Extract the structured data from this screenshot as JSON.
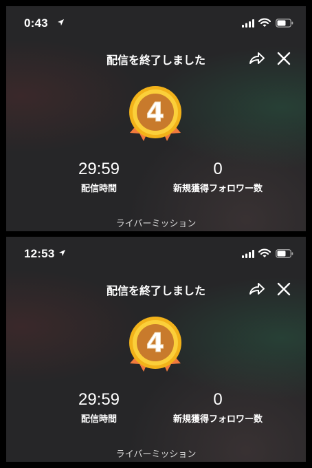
{
  "screens": [
    {
      "status_bar": {
        "time": "0:43",
        "location_icon": "location-arrow-icon",
        "signal_icon": "signal-icon",
        "wifi_icon": "wifi-icon",
        "battery_icon": "battery-icon"
      },
      "header": {
        "title": "配信を終了しました",
        "share_icon": "share-icon",
        "close_icon": "close-icon"
      },
      "medal": {
        "rank": "4",
        "colors": {
          "gold": "#f2b21a",
          "ribbon": "#f27a3c",
          "inner": "#c87a2c"
        }
      },
      "stats": {
        "duration_value": "29:59",
        "duration_label": "配信時間",
        "followers_value": "0",
        "followers_label": "新規獲得フォロワー数"
      },
      "footer": {
        "mission_link": "ライバーミッション"
      }
    },
    {
      "status_bar": {
        "time": "12:53",
        "location_icon": "location-arrow-icon",
        "signal_icon": "signal-icon",
        "wifi_icon": "wifi-icon",
        "battery_icon": "battery-icon"
      },
      "header": {
        "title": "配信を終了しました",
        "share_icon": "share-icon",
        "close_icon": "close-icon"
      },
      "medal": {
        "rank": "4",
        "colors": {
          "gold": "#f2b21a",
          "ribbon": "#f27a3c",
          "inner": "#c87a2c"
        }
      },
      "stats": {
        "duration_value": "29:59",
        "duration_label": "配信時間",
        "followers_value": "0",
        "followers_label": "新規獲得フォロワー数"
      },
      "footer": {
        "mission_link": "ライバーミッション"
      }
    }
  ]
}
